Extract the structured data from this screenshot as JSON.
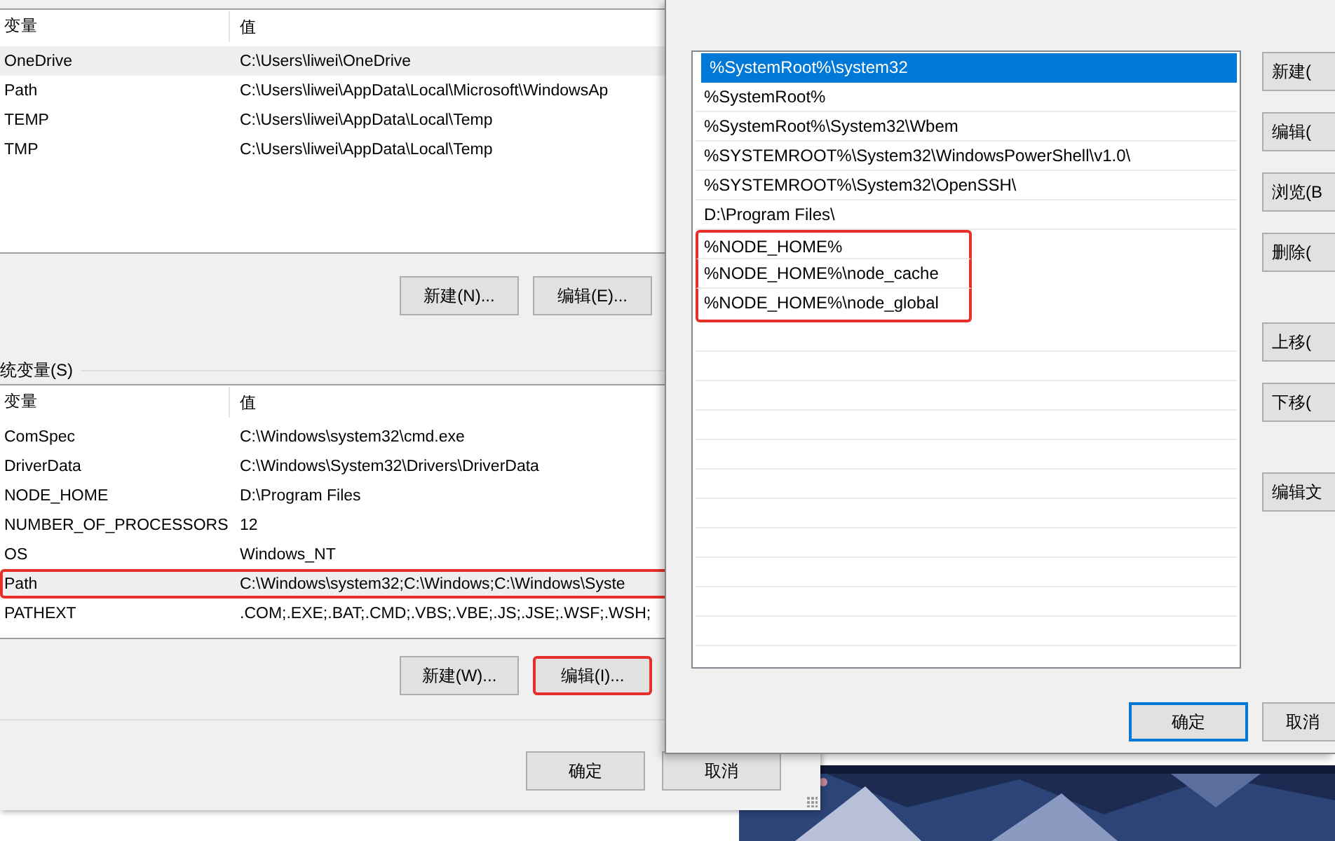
{
  "user_variables": {
    "columns": [
      "变量",
      "值"
    ],
    "rows": [
      {
        "name": "OneDrive",
        "value": "C:\\Users\\liwei\\OneDrive",
        "selected": true,
        "highlighted": false
      },
      {
        "name": "Path",
        "value": "C:\\Users\\liwei\\AppData\\Local\\Microsoft\\WindowsAp",
        "selected": false,
        "highlighted": false
      },
      {
        "name": "TEMP",
        "value": "C:\\Users\\liwei\\AppData\\Local\\Temp",
        "selected": false,
        "highlighted": false
      },
      {
        "name": "TMP",
        "value": "C:\\Users\\liwei\\AppData\\Local\\Temp",
        "selected": false,
        "highlighted": false
      }
    ],
    "buttons": [
      {
        "label": "新建(N)...",
        "highlighted": false
      },
      {
        "label": "编辑(E)...",
        "highlighted": false
      }
    ]
  },
  "system_variables": {
    "label": "统变量(S)",
    "columns": [
      "变量",
      "值"
    ],
    "rows": [
      {
        "name": "ComSpec",
        "value": "C:\\Windows\\system32\\cmd.exe",
        "selected": false,
        "highlighted": false
      },
      {
        "name": "DriverData",
        "value": "C:\\Windows\\System32\\Drivers\\DriverData",
        "selected": false,
        "highlighted": false
      },
      {
        "name": "NODE_HOME",
        "value": "D:\\Program Files",
        "selected": false,
        "highlighted": false
      },
      {
        "name": "NUMBER_OF_PROCESSORS",
        "value": "12",
        "selected": false,
        "highlighted": false
      },
      {
        "name": "OS",
        "value": "Windows_NT",
        "selected": false,
        "highlighted": false
      },
      {
        "name": "Path",
        "value": "C:\\Windows\\system32;C:\\Windows;C:\\Windows\\Syste",
        "selected": true,
        "highlighted": true
      },
      {
        "name": "PATHEXT",
        "value": ".COM;.EXE;.BAT;.CMD;.VBS;.VBE;.JS;.JSE;.WSF;.WSH;",
        "selected": false,
        "highlighted": false
      }
    ],
    "buttons": [
      {
        "label": "新建(W)...",
        "highlighted": false
      },
      {
        "label": "编辑(I)...",
        "highlighted": true
      }
    ]
  },
  "dialog_buttons": [
    {
      "label": "确定"
    },
    {
      "label": "取消"
    }
  ],
  "edit_dialog": {
    "entries": [
      {
        "text": "%SystemRoot%\\system32",
        "selected": true,
        "highlighted": false
      },
      {
        "text": "%SystemRoot%",
        "selected": false,
        "highlighted": false
      },
      {
        "text": "%SystemRoot%\\System32\\Wbem",
        "selected": false,
        "highlighted": false
      },
      {
        "text": "%SYSTEMROOT%\\System32\\WindowsPowerShell\\v1.0\\",
        "selected": false,
        "highlighted": false
      },
      {
        "text": "%SYSTEMROOT%\\System32\\OpenSSH\\",
        "selected": false,
        "highlighted": false
      },
      {
        "text": "D:\\Program Files\\",
        "selected": false,
        "highlighted": false
      },
      {
        "text": "%NODE_HOME%",
        "selected": false,
        "highlighted": true
      },
      {
        "text": "%NODE_HOME%\\node_cache",
        "selected": false,
        "highlighted": true
      },
      {
        "text": "%NODE_HOME%\\node_global",
        "selected": false,
        "highlighted": true
      }
    ],
    "side_button_groups": [
      [
        "新建(",
        "编辑(",
        "浏览(B",
        "删除("
      ],
      [
        "上移(",
        "下移("
      ],
      [
        "编辑文"
      ]
    ],
    "buttons": [
      {
        "label": "确定",
        "default": true
      },
      {
        "label": "取消",
        "default": false
      }
    ]
  }
}
